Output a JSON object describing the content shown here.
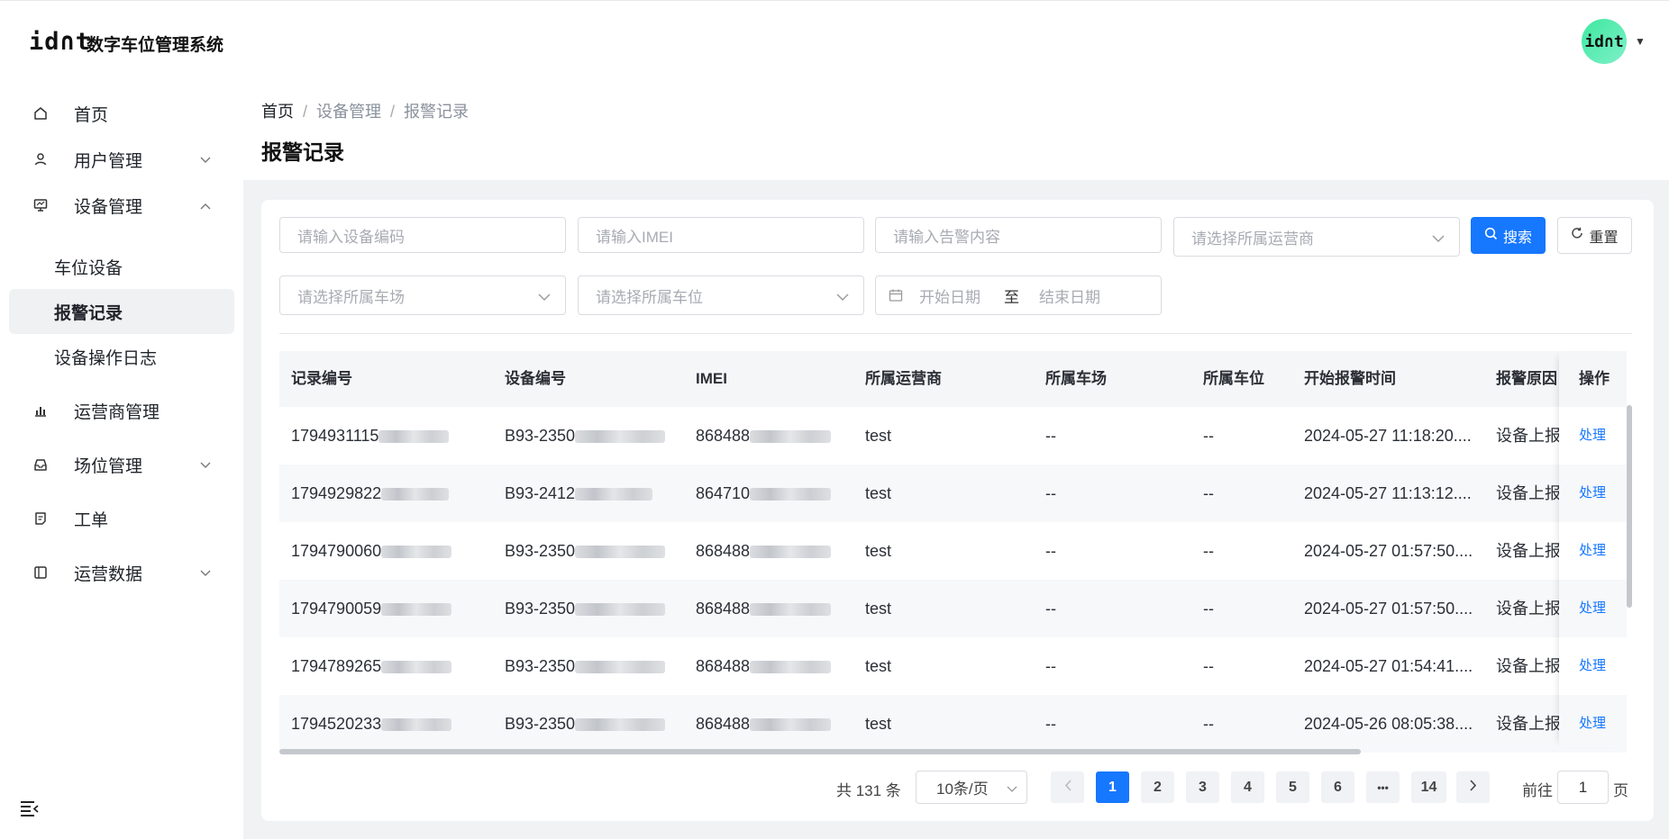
{
  "header": {
    "logo_text": "id∩t",
    "app_title": "数字车位管理系统",
    "avatar_text": "id∩t"
  },
  "sidebar": {
    "items": [
      {
        "label": "首页",
        "icon": "home-icon"
      },
      {
        "label": "用户管理",
        "icon": "user-icon",
        "expand": "chevron-down"
      },
      {
        "label": "设备管理",
        "icon": "monitor-icon",
        "expand": "chevron-up"
      },
      {
        "label": "运营商管理",
        "icon": "bar-chart-icon"
      },
      {
        "label": "场位管理",
        "icon": "inbox-icon",
        "expand": "chevron-down"
      },
      {
        "label": "工单",
        "icon": "document-icon"
      },
      {
        "label": "运营数据",
        "icon": "panel-icon",
        "expand": "chevron-down"
      }
    ],
    "sub_items": [
      {
        "label": "车位设备",
        "active": false
      },
      {
        "label": "报警记录",
        "active": true
      },
      {
        "label": "设备操作日志",
        "active": false
      }
    ]
  },
  "breadcrumb": [
    "首页",
    "设备管理",
    "报警记录"
  ],
  "page_title": "报警记录",
  "filters": {
    "device_code_placeholder": "请输入设备编码",
    "imei_placeholder": "请输入IMEI",
    "alarm_content_placeholder": "请输入告警内容",
    "operator_placeholder": "请选择所属运营商",
    "parking_lot_placeholder": "请选择所属车场",
    "parking_space_placeholder": "请选择所属车位",
    "start_date_placeholder": "开始日期",
    "date_separator": "至",
    "end_date_placeholder": "结束日期",
    "search_label": "搜索",
    "reset_label": "重置"
  },
  "table": {
    "columns": [
      "记录编号",
      "设备编号",
      "IMEI",
      "所属运营商",
      "所属车场",
      "所属车位",
      "开始报警时间",
      "报警原因",
      "操作"
    ],
    "rows": [
      {
        "record_no": "1794931115",
        "device_no": "B93-2350",
        "imei": "868488",
        "operator": "test",
        "lot": "--",
        "space": "--",
        "start_time": "2024-05-27 11:18:20....",
        "reason": "设备上报",
        "action": "处理"
      },
      {
        "record_no": "1794929822",
        "device_no": "B93-2412",
        "imei": "864710",
        "operator": "test",
        "lot": "--",
        "space": "--",
        "start_time": "2024-05-27 11:13:12....",
        "reason": "设备上报",
        "action": "处理"
      },
      {
        "record_no": "1794790060",
        "device_no": "B93-2350",
        "imei": "868488",
        "operator": "test",
        "lot": "--",
        "space": "--",
        "start_time": "2024-05-27 01:57:50....",
        "reason": "设备上报",
        "action": "处理"
      },
      {
        "record_no": "1794790059",
        "device_no": "B93-2350",
        "imei": "868488",
        "operator": "test",
        "lot": "--",
        "space": "--",
        "start_time": "2024-05-27 01:57:50....",
        "reason": "设备上报",
        "action": "处理"
      },
      {
        "record_no": "1794789265",
        "device_no": "B93-2350",
        "imei": "868488",
        "operator": "test",
        "lot": "--",
        "space": "--",
        "start_time": "2024-05-27 01:54:41....",
        "reason": "设备上报",
        "action": "处理"
      },
      {
        "record_no": "1794520233",
        "device_no": "B93-2350",
        "imei": "868488",
        "operator": "test",
        "lot": "--",
        "space": "--",
        "start_time": "2024-05-26 08:05:38....",
        "reason": "设备上报",
        "action": "处理"
      }
    ]
  },
  "pagination": {
    "total_text": "共 131 条",
    "page_size": "10条/页",
    "pages": [
      "1",
      "2",
      "3",
      "4",
      "5",
      "6",
      "•••",
      "14"
    ],
    "current": "1",
    "goto_label": "前往",
    "goto_value": "1",
    "page_unit": "页"
  },
  "colors": {
    "primary": "#1677ff",
    "avatar_gradient": "#3ee8a0"
  }
}
